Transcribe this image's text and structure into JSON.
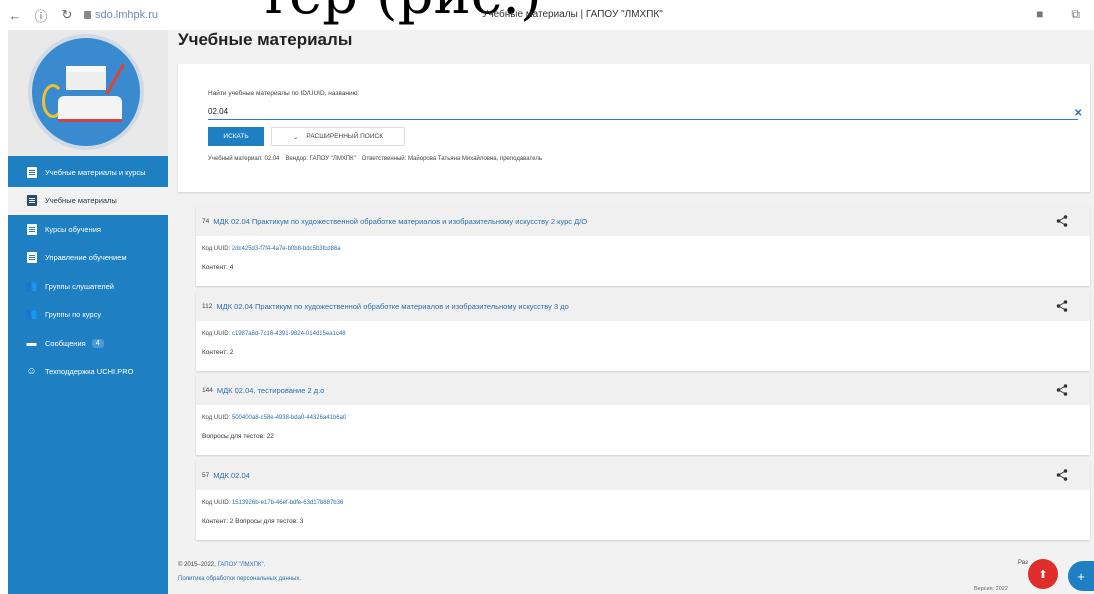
{
  "doc_header": {
    "cropped_text": "тер (рис.)"
  },
  "browser": {
    "url": "sdo.lmhpk.ru",
    "tab_title": "Учебные материалы | ГАПОУ \"ЛМХПК\""
  },
  "sidebar": {
    "items": [
      {
        "label": "Учебные материалы и курсы",
        "icon": "book-icon",
        "active": false
      },
      {
        "label": "Учебные материалы",
        "icon": "book-icon",
        "active": true
      },
      {
        "label": "Курсы обучения",
        "icon": "list-icon",
        "active": false
      },
      {
        "label": "Управление обучением",
        "icon": "clipboard-icon",
        "active": false
      },
      {
        "label": "Группы слушателей",
        "icon": "people-icon",
        "active": false
      },
      {
        "label": "Группы по курсу",
        "icon": "people-icon",
        "active": false
      },
      {
        "label": "Сообщения",
        "icon": "message-icon",
        "active": false,
        "badge": "4"
      },
      {
        "label": "Техподдержка UCHI.PRO",
        "icon": "support-icon",
        "active": false
      }
    ]
  },
  "main": {
    "title": "Учебные материалы",
    "search": {
      "label": "Найти учебные материалы по ID/UUID, названию:",
      "value": "02.04",
      "search_button": "ИСКАТЬ",
      "advanced_button": "РАСШИРЕННЫЙ ПОИСК",
      "filters": [
        "Учебный материал: 02.04",
        "Вендор: ГАПОУ \"ЛМХПК\"",
        "Ответственный: Майорова Татьяна Михайловна, преподаватель"
      ]
    },
    "results": [
      {
        "id": "74",
        "title": "МДК 02.04 Практикум по художественной обработке материалов и изобразительному искусству 2 курс Д/О",
        "uuid_label": "Код UUID:",
        "uuid": "2dc425d3-f7f4-4a7e-b0b8-bdc5b3fcd86a",
        "meta": "Контент: 4"
      },
      {
        "id": "112",
        "title": "МДК 02.04 Практикум по художественной обработке материалов и изобразительному искусству 3 до",
        "uuid_label": "Код UUID:",
        "uuid": "c1987a8d-7c16-4391-9824-014d15ea1c48",
        "meta": "Контент: 2"
      },
      {
        "id": "144",
        "title": "МДК 02.04. тестирование 2 д.о",
        "uuid_label": "Код UUID:",
        "uuid": "500400a8-c58e-4938-bda0-44326a41b6a0",
        "meta": "Вопросы для тестов: 22"
      },
      {
        "id": "57",
        "title": "МДК 02.04",
        "uuid_label": "Код UUID:",
        "uuid": "1513926b-e17b-46ef-bdfe-63d17b887b36",
        "meta": "Контент: 2   Вопросы для тестов: 3"
      }
    ],
    "footer": {
      "copyright": "© 2015–2022,",
      "company": "ГАПОУ \"ЛМХПК\".",
      "policy": "Политика обработки персональных данных.",
      "right_text": "Раз",
      "right_text2": "Версия: 2022"
    }
  },
  "colors": {
    "sidebar": "#1f7fc3",
    "accent": "#2a6fb0",
    "fab_red": "#e12c2c"
  }
}
